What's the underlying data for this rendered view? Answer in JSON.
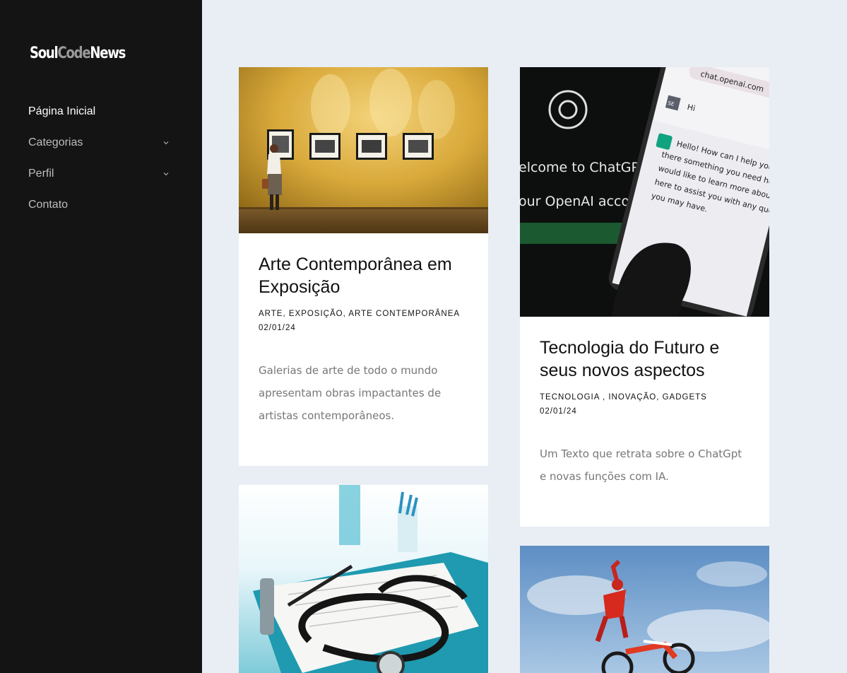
{
  "brand": {
    "part1": "Soul",
    "part2": "Code",
    "part3": "News"
  },
  "nav": [
    {
      "label": "Página Inicial",
      "active": true,
      "has_submenu": false
    },
    {
      "label": "Categorias",
      "active": false,
      "has_submenu": true
    },
    {
      "label": "Perfil",
      "active": false,
      "has_submenu": true
    },
    {
      "label": "Contato",
      "active": false,
      "has_submenu": false
    }
  ],
  "posts": [
    {
      "title": "Arte Contemporânea em Exposição",
      "tags": "ARTE, EXPOSIÇÃO, ARTE CONTEMPORÂNEA",
      "date": "02/01/24",
      "excerpt": "Galerias de arte de todo o mundo apresentam obras impactantes de artistas contemporâneos.",
      "image": "art-gallery-photo"
    },
    {
      "title": "Tecnologia do Futuro e seus novos aspectos",
      "tags": "TECNOLOGIA , INOVAÇÃO, GADGETS",
      "date": "02/01/24",
      "excerpt": "Um Texto que retrata sobre o ChatGpt e novas funções com IA.",
      "image": "chatgpt-phone-photo",
      "image_text": {
        "url": "chat.openai.com",
        "welcome_line1": "elcome to ChatGPT",
        "welcome_line2": "our OpenAI account",
        "user_msg": "Hi",
        "avatar": "SE",
        "reply": [
          "Hello! How can I help you today? Is",
          "there something you need help with or",
          "would like to learn more about? I'm",
          "here to assist you with any questions",
          "you may have."
        ]
      }
    },
    {
      "image": "stethoscope-photo"
    },
    {
      "image": "motocross-photo"
    }
  ]
}
